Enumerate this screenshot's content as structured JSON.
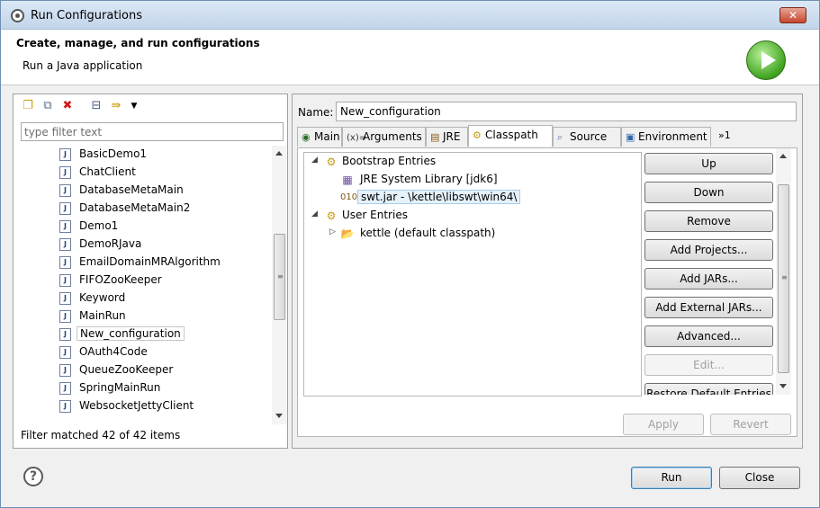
{
  "window": {
    "title": "Run Configurations",
    "close_label": "✕"
  },
  "header": {
    "title": "Create, manage, and run configurations",
    "subtitle": "Run a Java application",
    "banner_icon": "run-icon"
  },
  "left": {
    "filter_placeholder": "type filter text",
    "filter_value": "",
    "items": [
      {
        "label": "BasicDemo1"
      },
      {
        "label": "ChatClient"
      },
      {
        "label": "DatabaseMetaMain"
      },
      {
        "label": "DatabaseMetaMain2"
      },
      {
        "label": "Demo1"
      },
      {
        "label": "DemoRJava"
      },
      {
        "label": "EmailDomainMRAlgorithm"
      },
      {
        "label": "FIFOZooKeeper"
      },
      {
        "label": "Keyword"
      },
      {
        "label": "MainRun"
      },
      {
        "label": "New_configuration"
      },
      {
        "label": "OAuth4Code"
      },
      {
        "label": "QueueZooKeeper"
      },
      {
        "label": "SpringMainRun"
      },
      {
        "label": "WebsocketJettyClient"
      }
    ],
    "selected": "New_configuration",
    "footer": "Filter matched 42 of 42 items",
    "toolbar_icons": [
      "new-configuration-icon",
      "duplicate-icon",
      "delete-icon",
      "collapse-all-icon",
      "filter-icon",
      "dropdown-icon"
    ]
  },
  "right": {
    "name_label": "Name:",
    "name_value": "New_configuration",
    "tabs": [
      {
        "label": "Main",
        "icon": "main-tab-icon"
      },
      {
        "label": "Arguments",
        "icon": "arguments-tab-icon"
      },
      {
        "label": "JRE",
        "icon": "jre-tab-icon"
      },
      {
        "label": "Classpath",
        "icon": "classpath-tab-icon"
      },
      {
        "label": "Source",
        "icon": "source-tab-icon"
      },
      {
        "label": "Environment",
        "icon": "environment-tab-icon"
      }
    ],
    "active_tab": "Classpath",
    "more_tabs": "»1",
    "classpath": {
      "bootstrap": "Bootstrap Entries",
      "jre_lib": "JRE System Library [jdk6]",
      "swt_jar": "swt.jar - \\kettle\\libswt\\win64\\",
      "user": "User Entries",
      "kettle": "kettle (default classpath)"
    },
    "buttons": {
      "up": "Up",
      "down": "Down",
      "remove": "Remove",
      "add_projects": "Add Projects...",
      "add_jars": "Add JARs...",
      "add_external_jars": "Add External JARs...",
      "advanced": "Advanced...",
      "edit": "Edit...",
      "restore": "Restore Default Entries"
    },
    "apply": "Apply",
    "revert": "Revert"
  },
  "footer": {
    "help": "?",
    "run": "Run",
    "close": "Close"
  },
  "colors": {
    "selection": "#e5f1fb",
    "run_green": "#3fa41f",
    "close_red": "#c7452c"
  }
}
